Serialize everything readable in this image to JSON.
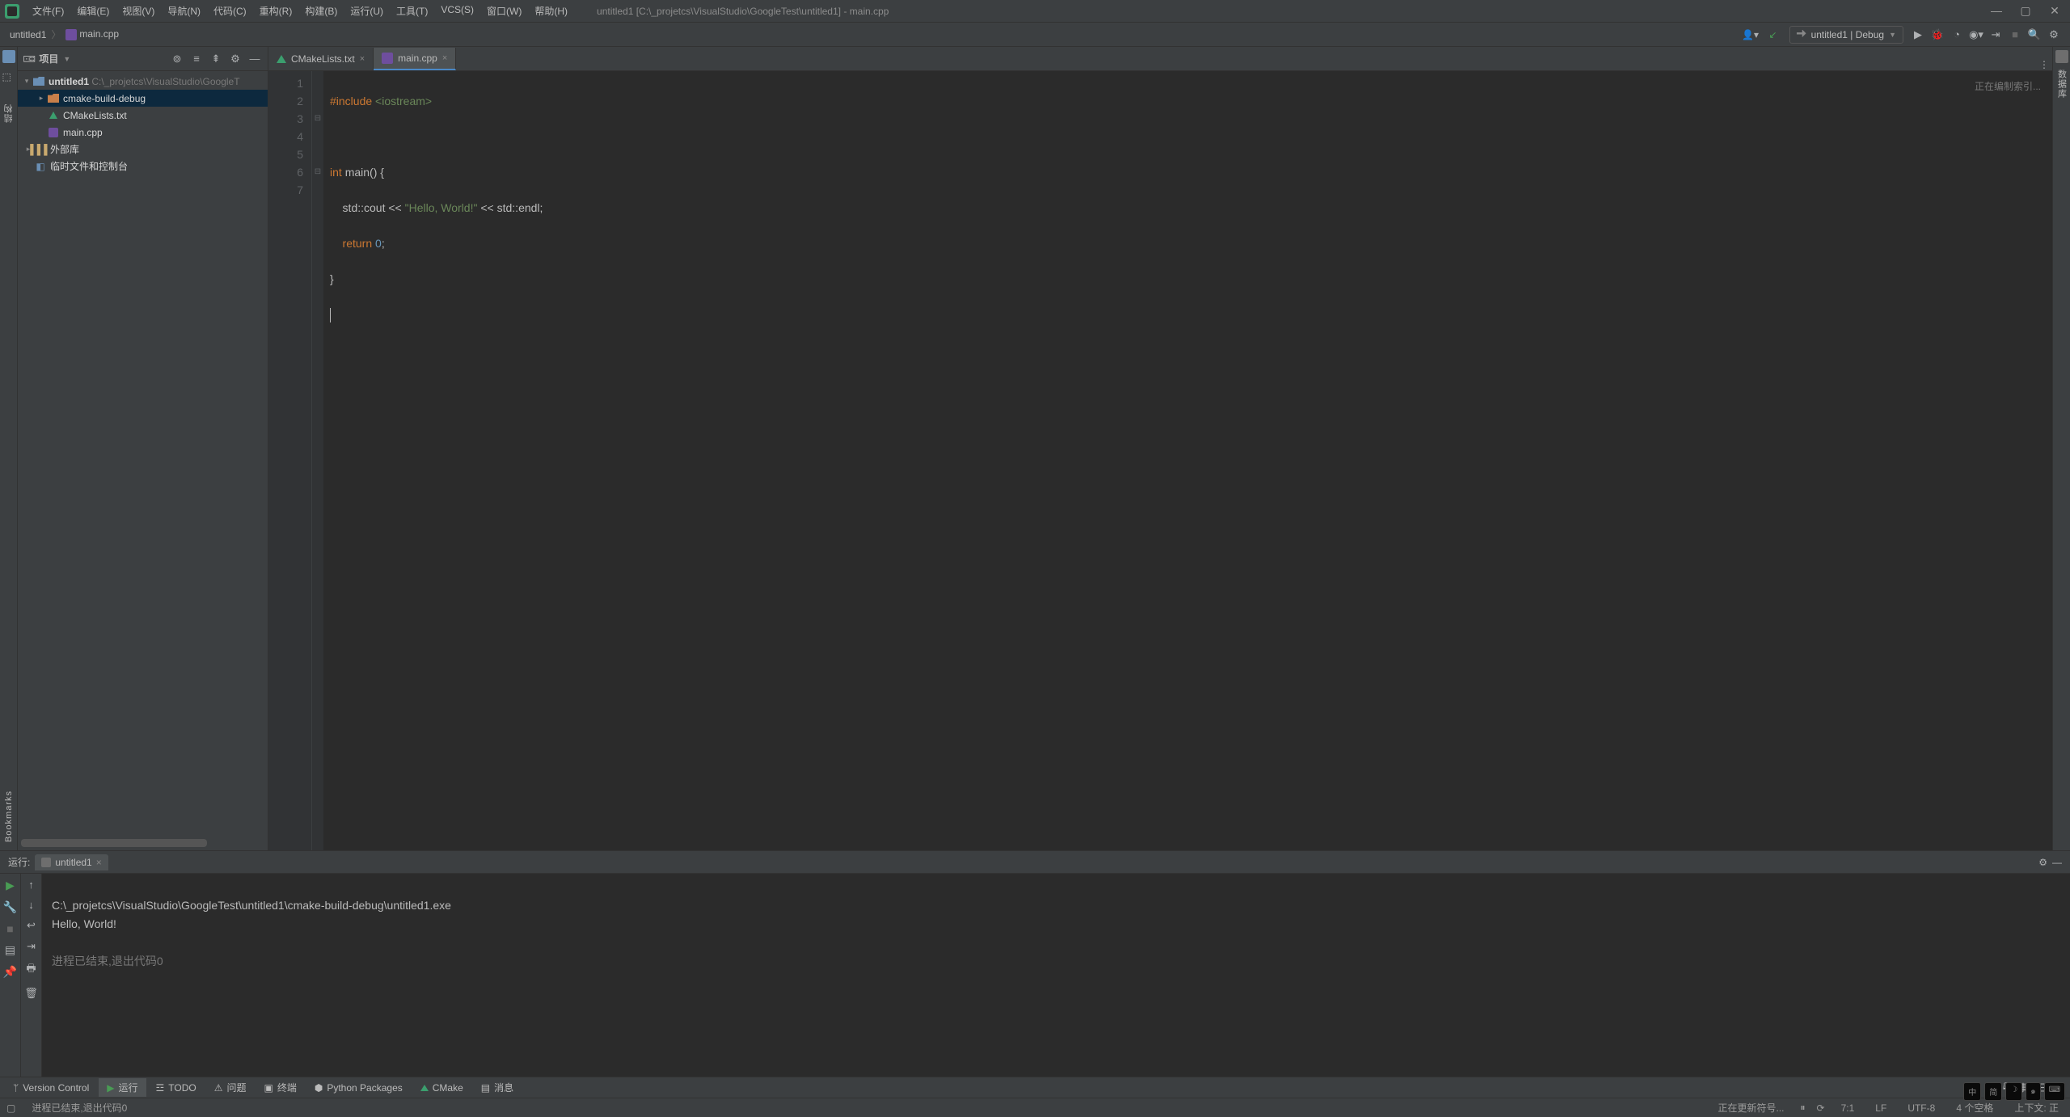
{
  "window": {
    "title": "untitled1 [C:\\_projetcs\\VisualStudio\\GoogleTest\\untitled1] - main.cpp"
  },
  "menu": {
    "file": "文件(F)",
    "edit": "编辑(E)",
    "view": "视图(V)",
    "nav": "导航(N)",
    "code": "代码(C)",
    "refactor": "重构(R)",
    "build": "构建(B)",
    "run": "运行(U)",
    "tools": "工具(T)",
    "vcs": "VCS(S)",
    "window": "窗口(W)",
    "help": "帮助(H)"
  },
  "breadcrumb": {
    "root": "untitled1",
    "file": "main.cpp"
  },
  "runconfig": {
    "label": "untitled1 | Debug"
  },
  "project_panel": {
    "title": "项目",
    "root": {
      "name": "untitled1",
      "path": "C:\\_projetcs\\VisualStudio\\GoogleT"
    },
    "items": [
      {
        "name": "cmake-build-debug",
        "kind": "folder-orange",
        "depth": 1,
        "expandable": true,
        "selected": true
      },
      {
        "name": "CMakeLists.txt",
        "kind": "cmake",
        "depth": 1
      },
      {
        "name": "main.cpp",
        "kind": "cpp",
        "depth": 1
      },
      {
        "name": "外部库",
        "kind": "lib",
        "depth": 0,
        "expandable": true
      },
      {
        "name": "临时文件和控制台",
        "kind": "scratch",
        "depth": 0
      }
    ]
  },
  "editor": {
    "tabs": [
      {
        "name": "CMakeLists.txt",
        "icon": "cmake",
        "active": false
      },
      {
        "name": "main.cpp",
        "icon": "cpp",
        "active": true
      }
    ],
    "lines": [
      "1",
      "2",
      "3",
      "4",
      "5",
      "6",
      "7"
    ],
    "code": {
      "l1_pre": "#include",
      "l1_inc": " <iostream>",
      "l3_a": "int ",
      "l3_b": "main",
      "l3_c": "() {",
      "l4_a": "    std",
      "l4_b": "::",
      "l4_c": "cout ",
      "l4_d": "<< ",
      "l4_e": "\"Hello, World!\"",
      "l4_f": " << ",
      "l4_g": "std",
      "l4_h": "::",
      "l4_i": "endl",
      "l4_j": ";",
      "l5_a": "    return ",
      "l5_b": "0",
      "l5_c": ";",
      "l6": "}"
    },
    "indexing": "正在编制索引..."
  },
  "run_panel": {
    "header": "运行:",
    "tab": "untitled1",
    "console": {
      "line1": "C:\\_projetcs\\VisualStudio\\GoogleTest\\untitled1\\cmake-build-debug\\untitled1.exe",
      "line2": "Hello, World!",
      "line3": "",
      "line4": "进程已结束,退出代码0"
    }
  },
  "bottom_tabs": {
    "vc": "Version Control",
    "run": "运行",
    "todo": "TODO",
    "problems": "问题",
    "terminal": "终端",
    "py": "Python Packages",
    "cmake": "CMake",
    "messages": "消息",
    "events": "事件日志"
  },
  "status": {
    "msg": "进程已结束,退出代码0",
    "sync": "正在更新符号...",
    "pos": "7:1",
    "le": "LF",
    "enc": "UTF-8",
    "indent": "4 个空格",
    "ctx": "上下文: 正"
  },
  "vtabs": {
    "structure": "结构",
    "bookmarks": "Bookmarks",
    "db": "数据库"
  }
}
